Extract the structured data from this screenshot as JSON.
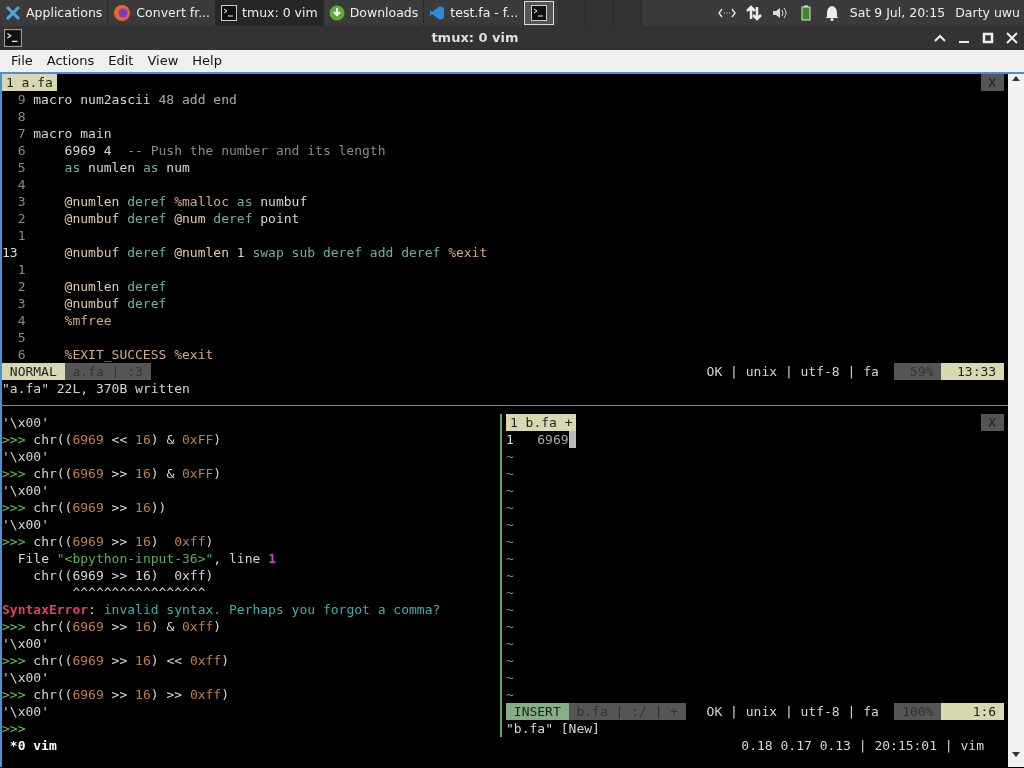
{
  "taskbar": {
    "items": [
      {
        "label": "Applications",
        "kind": "xfce",
        "selected": false
      },
      {
        "label": "Convert fr...",
        "kind": "firefox",
        "selected": false
      },
      {
        "label": "tmux: 0 vim",
        "kind": "terminal",
        "selected": true
      },
      {
        "label": "Downloads",
        "kind": "download",
        "selected": false
      },
      {
        "label": "test.fa - f...",
        "kind": "vscode",
        "selected": false
      }
    ],
    "clock": "Sat  9 Jul, 20:15",
    "user": "Darty uwu"
  },
  "window": {
    "title": "tmux: 0 vim",
    "menu": [
      "File",
      "Actions",
      "Edit",
      "View",
      "Help"
    ]
  },
  "top_editor": {
    "tab": "1 a.fa",
    "close": "X",
    "lines": [
      {
        "number": "9",
        "current": false,
        "tokens": [
          {
            "text": "macro num2ascii ",
            "kind": "plain"
          },
          {
            "text": "48 add end",
            "kind": "dim"
          }
        ]
      },
      {
        "number": "8",
        "current": false
      },
      {
        "number": "7",
        "current": false,
        "tokens": [
          {
            "text": "macro main",
            "kind": "plain"
          }
        ]
      },
      {
        "number": "6",
        "current": false,
        "tokens": [
          {
            "text": "    6969 4  ",
            "kind": "plain"
          },
          {
            "text": "-- Push the number and its length",
            "kind": "comment"
          }
        ]
      },
      {
        "number": "5",
        "current": false,
        "tokens": [
          {
            "text": "    as",
            "kind": "kw"
          },
          {
            "text": " numlen ",
            "kind": "plain"
          },
          {
            "text": "as",
            "kind": "kw"
          },
          {
            "text": " num",
            "kind": "plain"
          }
        ]
      },
      {
        "number": "4",
        "current": false
      },
      {
        "number": "3",
        "current": false,
        "tokens": [
          {
            "text": "    @numlen",
            "kind": "var"
          },
          {
            "text": " deref ",
            "kind": "kw"
          },
          {
            "text": "%malloc",
            "kind": "macro"
          },
          {
            "text": " as ",
            "kind": "kw"
          },
          {
            "text": "numbuf",
            "kind": "plain"
          }
        ]
      },
      {
        "number": "2",
        "current": false,
        "tokens": [
          {
            "text": "    @numbuf",
            "kind": "var"
          },
          {
            "text": " deref ",
            "kind": "kw"
          },
          {
            "text": "@num",
            "kind": "var"
          },
          {
            "text": " deref ",
            "kind": "kw"
          },
          {
            "text": "point",
            "kind": "plain"
          }
        ]
      },
      {
        "number": "1",
        "current": false
      },
      {
        "number": "13",
        "current": true,
        "tokens": [
          {
            "text": "    @numbuf",
            "kind": "var"
          },
          {
            "text": " deref ",
            "kind": "kw"
          },
          {
            "text": "@numlen",
            "kind": "var"
          },
          {
            "text": " 1 ",
            "kind": "plain"
          },
          {
            "text": "swap sub deref add deref",
            "kind": "kw"
          },
          {
            "text": " %exit",
            "kind": "macro"
          }
        ]
      },
      {
        "number": "1",
        "current": false
      },
      {
        "number": "2",
        "current": false,
        "tokens": [
          {
            "text": "    @numlen",
            "kind": "var"
          },
          {
            "text": " deref",
            "kind": "kw"
          }
        ]
      },
      {
        "number": "3",
        "current": false,
        "tokens": [
          {
            "text": "    @numbuf",
            "kind": "var"
          },
          {
            "text": " deref",
            "kind": "kw"
          }
        ]
      },
      {
        "number": "4",
        "current": false,
        "tokens": [
          {
            "text": "    %mfree",
            "kind": "macro"
          }
        ]
      },
      {
        "number": "5",
        "current": false
      },
      {
        "number": "6",
        "current": false,
        "tokens": [
          {
            "text": "    %EXIT_SUCCESS %exit",
            "kind": "macro"
          }
        ]
      }
    ],
    "status": {
      "mode": "NORMAL",
      "kind": "normal",
      "file": "a.fa | :3",
      "info": "OK | unix | utf-8 | fa",
      "percent": "59%",
      "cursor": "13:33"
    },
    "message": "\"a.fa\" 22L, 370B written"
  },
  "python": {
    "lines": [
      [
        {
          "text": "'\\x00'",
          "kind": "plain"
        }
      ],
      [
        {
          "text": ">>> ",
          "kind": "prompt"
        },
        {
          "text": "chr((",
          "kind": "plain"
        },
        {
          "text": "6969",
          "kind": "num"
        },
        {
          "text": " << ",
          "kind": "plain"
        },
        {
          "text": "16",
          "kind": "num"
        },
        {
          "text": ") & ",
          "kind": "plain"
        },
        {
          "text": "0xFF",
          "kind": "num"
        },
        {
          "text": ")",
          "kind": "plain"
        }
      ],
      [
        {
          "text": "'\\x00'",
          "kind": "plain"
        }
      ],
      [
        {
          "text": ">>> ",
          "kind": "prompt"
        },
        {
          "text": "chr((",
          "kind": "plain"
        },
        {
          "text": "6969",
          "kind": "num"
        },
        {
          "text": " >> ",
          "kind": "plain"
        },
        {
          "text": "16",
          "kind": "num"
        },
        {
          "text": ") & ",
          "kind": "plain"
        },
        {
          "text": "0xFF",
          "kind": "num"
        },
        {
          "text": ")",
          "kind": "plain"
        }
      ],
      [
        {
          "text": "'\\x00'",
          "kind": "plain"
        }
      ],
      [
        {
          "text": ">>> ",
          "kind": "prompt"
        },
        {
          "text": "chr((",
          "kind": "plain"
        },
        {
          "text": "6969",
          "kind": "num"
        },
        {
          "text": " >> ",
          "kind": "plain"
        },
        {
          "text": "16",
          "kind": "num"
        },
        {
          "text": "))",
          "kind": "plain"
        }
      ],
      [
        {
          "text": "'\\x00'",
          "kind": "plain"
        }
      ],
      [
        {
          "text": ">>> ",
          "kind": "prompt"
        },
        {
          "text": "chr((",
          "kind": "plain"
        },
        {
          "text": "6969",
          "kind": "num"
        },
        {
          "text": " >> ",
          "kind": "plain"
        },
        {
          "text": "16",
          "kind": "num"
        },
        {
          "text": ")  ",
          "kind": "plain"
        },
        {
          "text": "0xff",
          "kind": "num"
        },
        {
          "text": ")",
          "kind": "plain"
        }
      ],
      [
        {
          "text": "  File ",
          "kind": "plain"
        },
        {
          "text": "\"<bpython-input-36>\"",
          "kind": "str"
        },
        {
          "text": ", line ",
          "kind": "plain"
        },
        {
          "text": "1",
          "kind": "lineno"
        }
      ],
      [
        {
          "text": "    chr((6969 >> 16)  0xff)",
          "kind": "plain"
        }
      ],
      [
        {
          "text": "         ^^^^^^^^^^^^^^^^^",
          "kind": "plain"
        }
      ],
      [
        {
          "text": "SyntaxError",
          "kind": "error"
        },
        {
          "text": ": ",
          "kind": "plain"
        },
        {
          "text": "invalid syntax. Perhaps you forgot a comma?",
          "kind": "errmsg"
        }
      ],
      [
        {
          "text": ">>> ",
          "kind": "prompt"
        },
        {
          "text": "chr((",
          "kind": "plain"
        },
        {
          "text": "6969",
          "kind": "num"
        },
        {
          "text": " >> ",
          "kind": "plain"
        },
        {
          "text": "16",
          "kind": "num"
        },
        {
          "text": ") & ",
          "kind": "plain"
        },
        {
          "text": "0xff",
          "kind": "num"
        },
        {
          "text": ")",
          "kind": "plain"
        }
      ],
      [
        {
          "text": "'\\x00'",
          "kind": "plain"
        }
      ],
      [
        {
          "text": ">>> ",
          "kind": "prompt"
        },
        {
          "text": "chr((",
          "kind": "plain"
        },
        {
          "text": "6969",
          "kind": "num"
        },
        {
          "text": " >> ",
          "kind": "plain"
        },
        {
          "text": "16",
          "kind": "num"
        },
        {
          "text": ") << ",
          "kind": "plain"
        },
        {
          "text": "0xff",
          "kind": "num"
        },
        {
          "text": ")",
          "kind": "plain"
        }
      ],
      [
        {
          "text": "'\\x00'",
          "kind": "plain"
        }
      ],
      [
        {
          "text": ">>> ",
          "kind": "prompt"
        },
        {
          "text": "chr((",
          "kind": "plain"
        },
        {
          "text": "6969",
          "kind": "num"
        },
        {
          "text": " >> ",
          "kind": "plain"
        },
        {
          "text": "16",
          "kind": "num"
        },
        {
          "text": ") >> ",
          "kind": "plain"
        },
        {
          "text": "0xff",
          "kind": "num"
        },
        {
          "text": ")",
          "kind": "plain"
        }
      ],
      [
        {
          "text": "'\\x00'",
          "kind": "plain"
        }
      ],
      [
        {
          "text": ">>>",
          "kind": "prompt"
        }
      ]
    ]
  },
  "bottom_editor": {
    "tab": "1 b.fa +",
    "close": "X",
    "lines": [
      {
        "number": "1",
        "current": true,
        "tokens": [
          {
            "text": "6969",
            "kind": "dim"
          }
        ]
      }
    ],
    "filler": [
      "~",
      "~",
      "~",
      "~",
      "~",
      "~",
      "~",
      "~",
      "~",
      "~",
      "~",
      "~",
      "~",
      "~",
      "~"
    ],
    "status": {
      "mode": "INSERT",
      "kind": "insert",
      "file": "b.fa | :/ | +",
      "info": "OK | unix | utf-8 | fa",
      "percent": "100%",
      "cursor": "1:6"
    },
    "message": "\"b.fa\" [New]"
  },
  "tmux_status": {
    "window": "*0 vim",
    "right": "0.18 0.17 0.13 | 20:15:01 | vim"
  }
}
